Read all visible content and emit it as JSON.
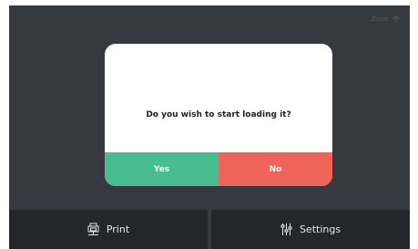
{
  "status": {
    "label": "Zone",
    "wifi_icon": "wifi-icon"
  },
  "dialog": {
    "message": "Do you wish to start loading it?",
    "yes_label": "Yes",
    "no_label": "No",
    "yes_color": "#49bc91",
    "no_color": "#ee6459"
  },
  "nav": {
    "print_label": "Print",
    "print_icon": "printer-icon",
    "settings_label": "Settings",
    "settings_icon": "sliders-icon"
  },
  "colors": {
    "background": "#363a40",
    "bar": "#23262b"
  }
}
